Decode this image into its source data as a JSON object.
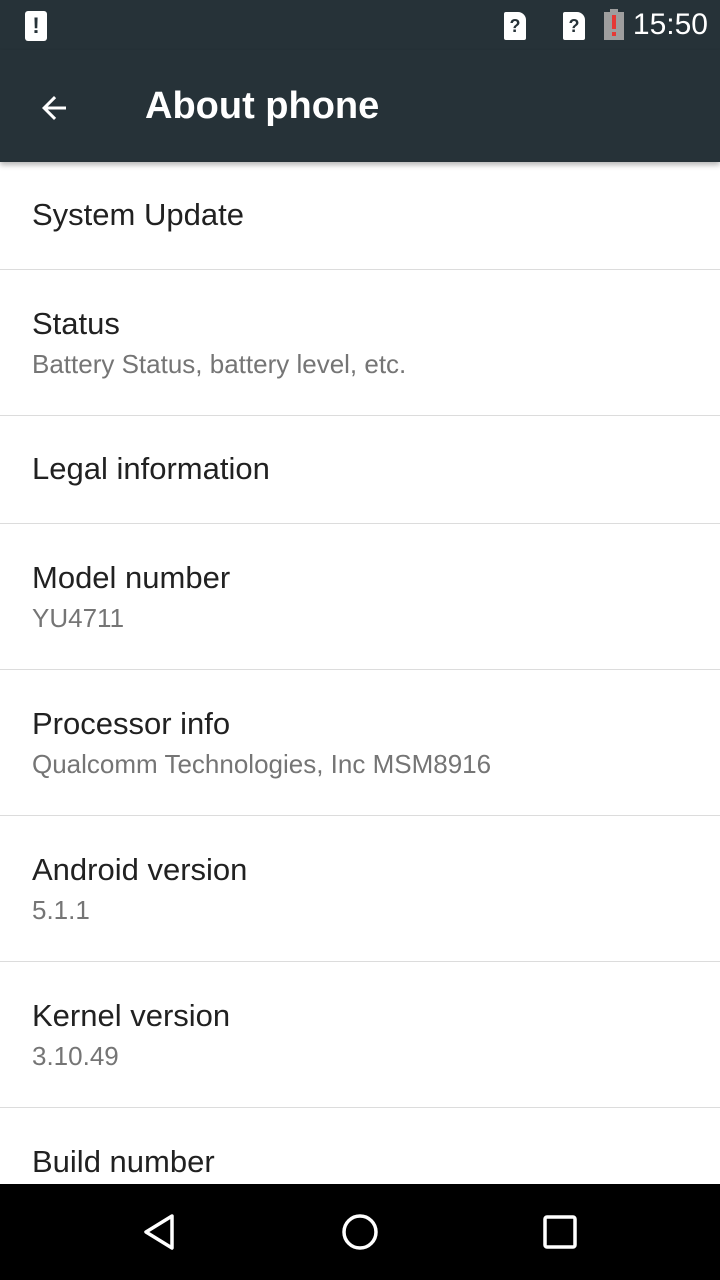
{
  "status_bar": {
    "time": "15:50",
    "left_icon": "notification-alert-icon",
    "sim1_icon": "sim-unknown-icon",
    "sim2_icon": "sim-unknown-icon",
    "battery_icon": "battery-alert-icon"
  },
  "toolbar": {
    "back_icon": "arrow-back-icon",
    "title": "About phone"
  },
  "items": [
    {
      "title": "System Update",
      "subtitle": ""
    },
    {
      "title": "Status",
      "subtitle": "Battery Status, battery level, etc."
    },
    {
      "title": "Legal information",
      "subtitle": ""
    },
    {
      "title": "Model number",
      "subtitle": "YU4711"
    },
    {
      "title": "Processor info",
      "subtitle": "Qualcomm Technologies, Inc MSM8916"
    },
    {
      "title": "Android version",
      "subtitle": "5.1.1"
    },
    {
      "title": "Kernel version",
      "subtitle": "3.10.49"
    },
    {
      "title": "Build number",
      "subtitle": ""
    }
  ],
  "nav_bar": {
    "back_icon": "nav-back-icon",
    "home_icon": "nav-home-icon",
    "recents_icon": "nav-recents-icon"
  },
  "colors": {
    "toolbar": "#263238",
    "primary_text": "#212121",
    "secondary_text": "#757575",
    "battery_alert": "#e53935"
  }
}
